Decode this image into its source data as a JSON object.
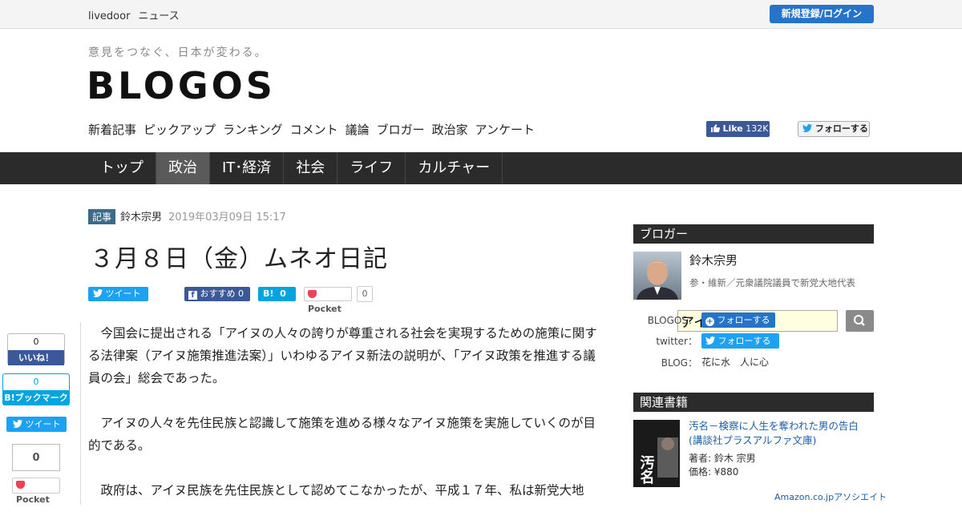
{
  "topbar": {
    "brand1": "livedoor",
    "brand2": "ニュース",
    "login": "新規登録/ログイン"
  },
  "header": {
    "tagline": "意見をつなぐ、日本が変わる。",
    "logo": "BLOGOS"
  },
  "subnav": [
    "新着記事",
    "ピックアップ",
    "ランキング",
    "コメント",
    "議論",
    "ブロガー",
    "政治家",
    "アンケート"
  ],
  "social": {
    "fb_like": "Like",
    "fb_count": "132K",
    "tw_follow": "フォローする"
  },
  "mainnav": [
    {
      "label": "トップ",
      "active": false
    },
    {
      "label": "政治",
      "active": true
    },
    {
      "label": "IT･経済",
      "active": false
    },
    {
      "label": "社会",
      "active": false
    },
    {
      "label": "ライフ",
      "active": false
    },
    {
      "label": "カルチャー",
      "active": false
    }
  ],
  "search": {
    "value": "アイヌ"
  },
  "article": {
    "tag": "記事",
    "author": "鈴木宗男",
    "date": "2019年03月09日 15:17",
    "title": "３月８日（金）ムネオ日記",
    "share": {
      "tweet": "ツイート",
      "fb": "おすすめ 0",
      "hb": "0",
      "pocket": "Pocket",
      "pocket_count": "0"
    },
    "paragraphs": [
      "今国会に提出される「アイヌの人々の誇りが尊重される社会を実現するための施策に関する法律案（アイヌ施策推進法案）」いわゆるアイヌ新法の説明が、「アイヌ政策を推進する議員の会」総会であった。",
      "アイヌの人々を先住民族と認識して施策を進める様々なアイヌ施策を実施していくのが目的である。",
      "政府は、アイヌ民族を先住民族として認めてこなかったが、平成１７年、私は新党大地"
    ]
  },
  "floating": {
    "like_count": "0",
    "like_label": "いいね！",
    "hb_count": "0",
    "hb_label": "B!ブックマーク",
    "tweet": "ツイート",
    "pocket_count": "0",
    "pocket": "Pocket"
  },
  "sidebar": {
    "blogger_heading": "ブロガー",
    "name": "鈴木宗男",
    "desc": "参・維新／元衆議院議員で新党大地代表",
    "blogos_label": "BLOGOS：",
    "blogos_follow": "フォローする",
    "twitter_label": "twitter：",
    "twitter_follow": "フォローする",
    "blog_label": "BLOG：",
    "blog_name": "花に水　人に心",
    "books_heading": "関連書籍",
    "book_title": "汚名－検察に人生を奪われた男の告白 (講談社プラスアルファ文庫)",
    "book_author": "著者: 鈴木 宗男",
    "book_price": "価格: ¥880",
    "book_cover_text": "汚名",
    "amazon": "Amazon.co.jpアソシエイト"
  }
}
